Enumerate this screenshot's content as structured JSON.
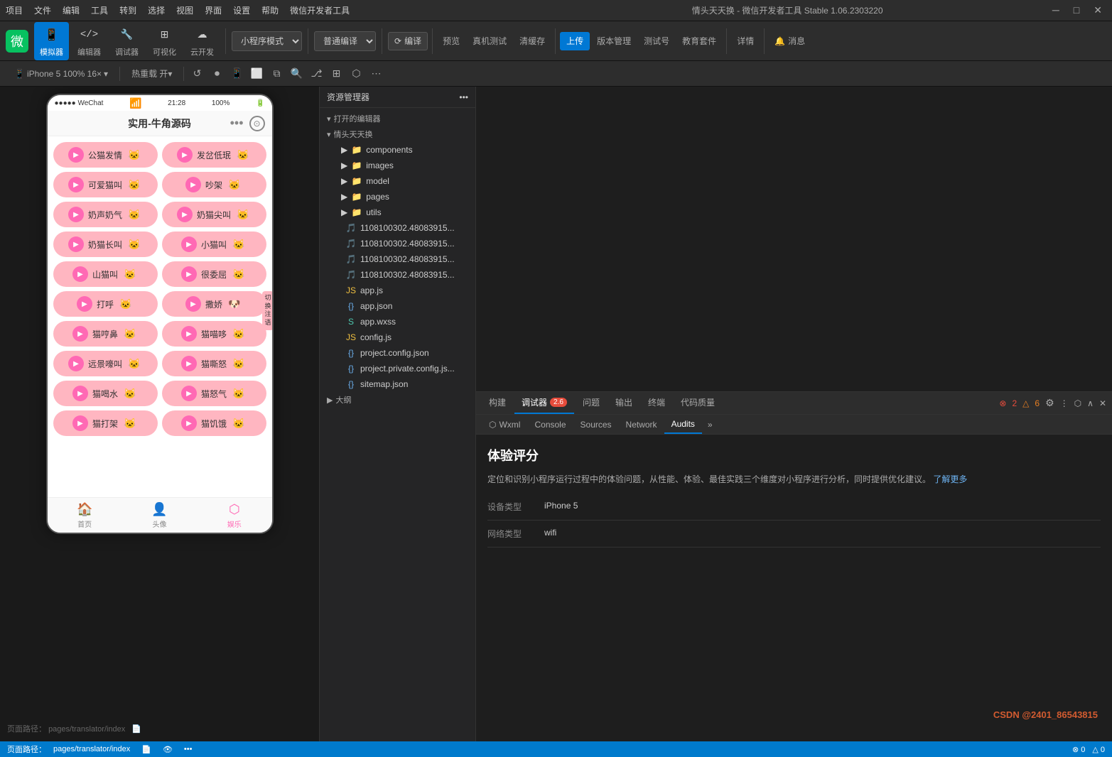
{
  "titlebar": {
    "menus": [
      "项目",
      "文件",
      "编辑",
      "工具",
      "转到",
      "选择",
      "视图",
      "界面",
      "设置",
      "帮助",
      "微信开发者工具"
    ],
    "title": "情头天天换 - 微信开发者工具 Stable 1.06.2303220",
    "controls": [
      "─",
      "□",
      "✕"
    ]
  },
  "toolbar": {
    "items": [
      {
        "icon": "📱",
        "label": "模拟器"
      },
      {
        "icon": "</>",
        "label": "编辑器"
      },
      {
        "icon": "🔧",
        "label": "调试器"
      },
      {
        "icon": "⊞",
        "label": "可视化"
      },
      {
        "icon": "☁",
        "label": "云开发"
      }
    ],
    "compile_mode_label": "小程序模式",
    "compile_type_label": "普通编译",
    "actions": [
      "编译",
      "预览",
      "真机测试",
      "清缓存",
      "上传",
      "版本管理",
      "测试号",
      "教育套件",
      "详情",
      "消息"
    ]
  },
  "toolbar2": {
    "device": "iPhone 5 100% 16×",
    "hotreload": "热重载 开▾",
    "icons": [
      "↺",
      "⏺",
      "📱",
      "◻",
      "⧉",
      "⬡",
      "⬡",
      "⬡",
      "⬡",
      "⬡"
    ]
  },
  "phone": {
    "time": "21:28",
    "battery": "100%",
    "signal": "●●●●●",
    "app": "WeChat",
    "wifi": "WiFi",
    "title": "实用-牛角源码",
    "sounds": [
      [
        "公猫发情",
        "发岔低珉"
      ],
      [
        "可爱猫叫",
        "吵架"
      ],
      [
        "奶声奶气",
        "奶猫尖叫"
      ],
      [
        "奶猫长叫",
        "小猫叫"
      ],
      [
        "山猫叫",
        "很委屈"
      ],
      [
        "打呼",
        "撒娇"
      ],
      [
        "猫哼鼻",
        "猫喵哆"
      ],
      [
        "远景嚎叫",
        "猫嘶怒"
      ],
      [
        "猫喝水",
        "猫怒气"
      ],
      [
        "猫打架",
        "猫饥饿"
      ]
    ],
    "navbar": [
      {
        "label": "首页",
        "active": false
      },
      {
        "label": "头像",
        "active": false
      },
      {
        "label": "娱乐",
        "active": true
      }
    ],
    "switch_label": "切\n换\n注\n语"
  },
  "filepanel": {
    "header": "资源管理器",
    "sections": [
      {
        "label": "打开的编辑器",
        "collapsed": false
      },
      {
        "label": "情头天天换",
        "collapsed": false
      }
    ],
    "tree": [
      {
        "type": "folder",
        "name": "components",
        "depth": 1,
        "icon": "folder"
      },
      {
        "type": "folder",
        "name": "images",
        "depth": 1,
        "icon": "folder"
      },
      {
        "type": "folder",
        "name": "model",
        "depth": 1,
        "icon": "folder"
      },
      {
        "type": "folder",
        "name": "pages",
        "depth": 1,
        "icon": "folder"
      },
      {
        "type": "folder",
        "name": "utils",
        "depth": 1,
        "icon": "folder"
      },
      {
        "type": "file",
        "name": "1108100302.48083915...",
        "depth": 2,
        "icon": "mp3"
      },
      {
        "type": "file",
        "name": "1108100302.48083915...",
        "depth": 2,
        "icon": "mp3"
      },
      {
        "type": "file",
        "name": "1108100302.48083915...",
        "depth": 2,
        "icon": "mp3"
      },
      {
        "type": "file",
        "name": "1108100302.48083915...",
        "depth": 2,
        "icon": "mp3"
      },
      {
        "type": "file",
        "name": "app.js",
        "depth": 2,
        "icon": "js"
      },
      {
        "type": "file",
        "name": "app.json",
        "depth": 2,
        "icon": "json"
      },
      {
        "type": "file",
        "name": "app.wxss",
        "depth": 2,
        "icon": "wxss"
      },
      {
        "type": "file",
        "name": "config.js",
        "depth": 2,
        "icon": "js"
      },
      {
        "type": "file",
        "name": "project.config.json",
        "depth": 2,
        "icon": "json"
      },
      {
        "type": "file",
        "name": "project.private.config.js...",
        "depth": 2,
        "icon": "json"
      },
      {
        "type": "file",
        "name": "sitemap.json",
        "depth": 2,
        "icon": "json"
      },
      {
        "type": "folder",
        "name": "大纲",
        "depth": 0,
        "icon": "folder"
      }
    ]
  },
  "debugger": {
    "tabs": [
      "构建",
      "调试器",
      "问题",
      "输出",
      "终端",
      "代码质量"
    ],
    "active_tab": "调试器",
    "badge": "2.6",
    "error_count": "2",
    "warn_count": "6",
    "subtabs": [
      "Wxml",
      "Console",
      "Sources",
      "Network",
      "Audits"
    ],
    "active_subtab": "Audits"
  },
  "audits": {
    "title": "体验评分",
    "description": "定位和识别小程序运行过程中的体验问题，从性能、体验、最佳实践三个维度对小程序进行分析，同时提供优化建议。",
    "learn_more": "了解更多",
    "device_label": "设备类型",
    "device_value": "iPhone 5",
    "network_label": "网络类型",
    "network_value": "wifi"
  },
  "statusbar": {
    "path_label": "页面路径：",
    "path": "pages/translator/index",
    "errors": "⊗ 0",
    "warnings": "△ 0"
  },
  "watermark": "CSDN @2401_86543815"
}
